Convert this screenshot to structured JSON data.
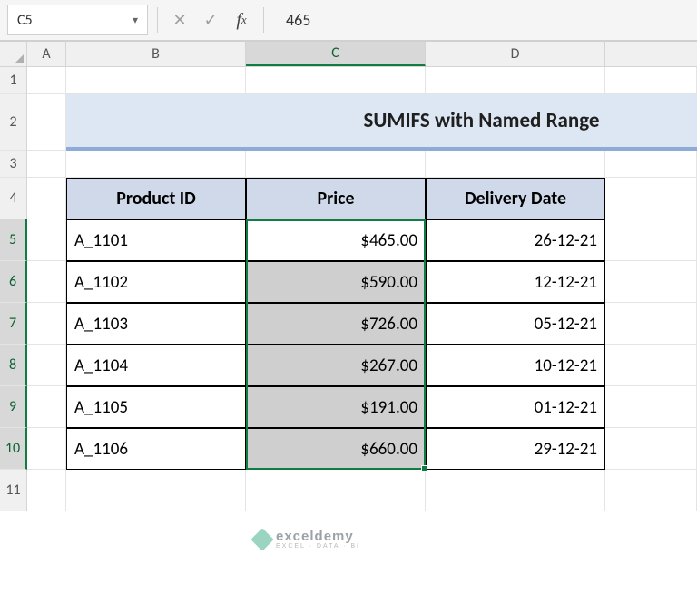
{
  "nameBox": "C5",
  "formulaValue": "465",
  "columns": [
    "A",
    "B",
    "C",
    "D"
  ],
  "activeColumn": "C",
  "rowNumbers": [
    "1",
    "2",
    "3",
    "4",
    "5",
    "6",
    "7",
    "8",
    "9",
    "10",
    "11"
  ],
  "activeRows": [
    "5",
    "6",
    "7",
    "8",
    "9",
    "10"
  ],
  "title": "SUMIFS with Named Range",
  "headers": {
    "b": "Product ID",
    "c": "Price",
    "d": "Delivery Date"
  },
  "rows": [
    {
      "id": "A_1101",
      "price": "$465.00",
      "date": "26-12-21"
    },
    {
      "id": "A_1102",
      "price": "$590.00",
      "date": "12-12-21"
    },
    {
      "id": "A_1103",
      "price": "$726.00",
      "date": "05-12-21"
    },
    {
      "id": "A_1104",
      "price": "$267.00",
      "date": "10-12-21"
    },
    {
      "id": "A_1105",
      "price": "$191.00",
      "date": "01-12-21"
    },
    {
      "id": "A_1106",
      "price": "$660.00",
      "date": "29-12-21"
    }
  ],
  "watermark": {
    "brand": "exceldemy",
    "tagline": "EXCEL · DATA · BI"
  },
  "selection": {
    "range": "C5:C10"
  }
}
